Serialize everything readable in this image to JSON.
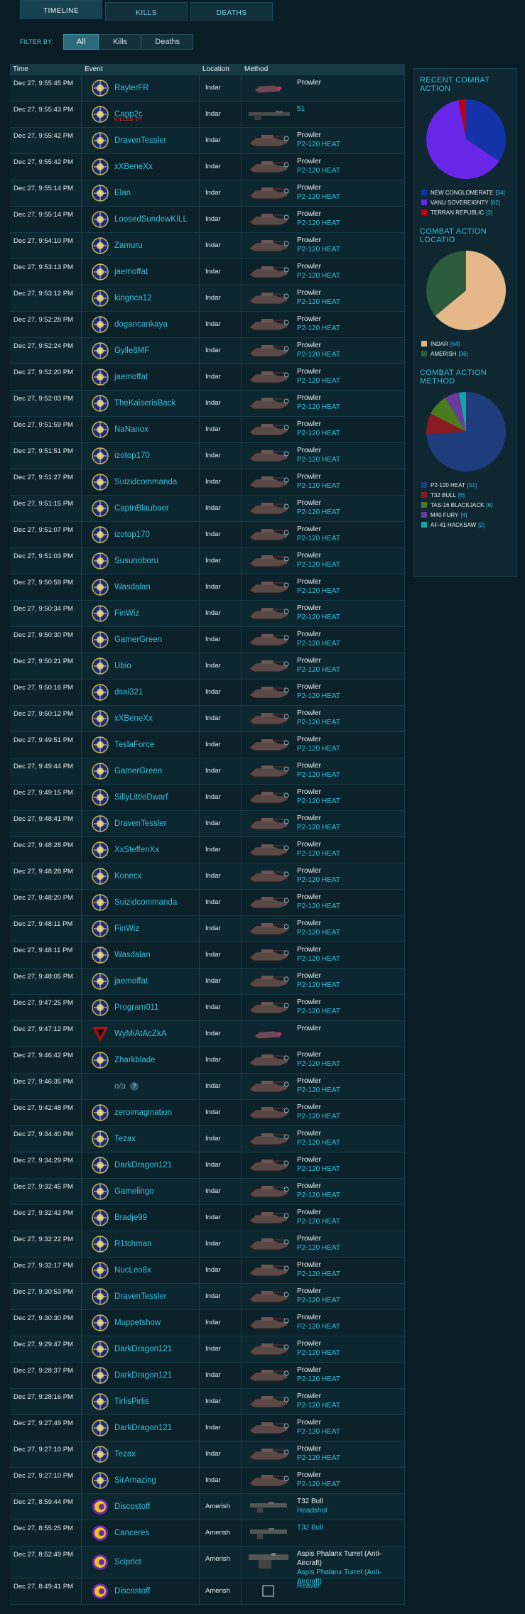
{
  "tabs": [
    "TIMELINE",
    "KILLS",
    "DEATHS"
  ],
  "filter": {
    "label": "FILTER BY:",
    "options": [
      "All",
      "Kills",
      "Deaths"
    ]
  },
  "table": {
    "headers": [
      "Time",
      "Event",
      "Location",
      "Method"
    ],
    "rows": [
      {
        "time": "Dec 27, 9:55:45 PM",
        "name": "RaylerFR",
        "faction": "nc",
        "location": "Indar",
        "vehicle": "prowler-small",
        "m1": "Prowler",
        "m2": ""
      },
      {
        "time": "Dec 27, 9:55:43 PM",
        "name": "Capp2c",
        "faction": "nc",
        "killed_by": "KILLED BY",
        "location": "Indar",
        "vehicle": "gun-long",
        "m1": "",
        "m2": "51"
      },
      {
        "time": "Dec 27, 9:55:42 PM",
        "name": "DravenTessler",
        "faction": "nc",
        "location": "Indar",
        "vehicle": "prowler",
        "m1": "Prowler",
        "m2": "P2-120 HEAT"
      },
      {
        "time": "Dec 27, 9:55:42 PM",
        "name": "xXBeneXx",
        "faction": "nc",
        "location": "Indar",
        "vehicle": "prowler",
        "m1": "Prowler",
        "m2": "P2-120 HEAT"
      },
      {
        "time": "Dec 27, 9:55:14 PM",
        "name": "Elan",
        "faction": "nc",
        "location": "Indar",
        "vehicle": "prowler",
        "m1": "Prowler",
        "m2": "P2-120 HEAT"
      },
      {
        "time": "Dec 27, 9:55:14 PM",
        "name": "LoosedSundewKILL",
        "faction": "nc",
        "location": "Indar",
        "vehicle": "prowler",
        "m1": "Prowler",
        "m2": "P2-120 HEAT"
      },
      {
        "time": "Dec 27, 9:54:10 PM",
        "name": "Zamuru",
        "faction": "nc",
        "location": "Indar",
        "vehicle": "prowler",
        "m1": "Prowler",
        "m2": "P2-120 HEAT"
      },
      {
        "time": "Dec 27, 9:53:13 PM",
        "name": "jaemoffat",
        "faction": "nc",
        "location": "Indar",
        "vehicle": "prowler",
        "m1": "Prowler",
        "m2": "P2-120 HEAT"
      },
      {
        "time": "Dec 27, 9:53:12 PM",
        "name": "kingnca12",
        "faction": "nc",
        "location": "Indar",
        "vehicle": "prowler",
        "m1": "Prowler",
        "m2": "P2-120 HEAT"
      },
      {
        "time": "Dec 27, 9:52:28 PM",
        "name": "dogancankaya",
        "faction": "nc",
        "location": "Indar",
        "vehicle": "prowler",
        "m1": "Prowler",
        "m2": "P2-120 HEAT"
      },
      {
        "time": "Dec 27, 9:52:24 PM",
        "name": "Gylle8MF",
        "faction": "nc",
        "location": "Indar",
        "vehicle": "prowler",
        "m1": "Prowler",
        "m2": "P2-120 HEAT"
      },
      {
        "time": "Dec 27, 9:52:20 PM",
        "name": "jaemoffat",
        "faction": "nc",
        "location": "Indar",
        "vehicle": "prowler",
        "m1": "Prowler",
        "m2": "P2-120 HEAT"
      },
      {
        "time": "Dec 27, 9:52:03 PM",
        "name": "TheKaiserisBack",
        "faction": "nc",
        "location": "Indar",
        "vehicle": "prowler",
        "m1": "Prowler",
        "m2": "P2-120 HEAT"
      },
      {
        "time": "Dec 27, 9:51:59 PM",
        "name": "NaNanox",
        "faction": "nc",
        "location": "Indar",
        "vehicle": "prowler",
        "m1": "Prowler",
        "m2": "P2-120 HEAT"
      },
      {
        "time": "Dec 27, 9:51:51 PM",
        "name": "izotop170",
        "faction": "nc",
        "location": "Indar",
        "vehicle": "prowler",
        "m1": "Prowler",
        "m2": "P2-120 HEAT"
      },
      {
        "time": "Dec 27, 9:51:27 PM",
        "name": "Suizidcommanda",
        "faction": "nc",
        "location": "Indar",
        "vehicle": "prowler",
        "m1": "Prowler",
        "m2": "P2-120 HEAT"
      },
      {
        "time": "Dec 27, 9:51:15 PM",
        "name": "CaptnBlaubaer",
        "faction": "nc",
        "location": "Indar",
        "vehicle": "prowler",
        "m1": "Prowler",
        "m2": "P2-120 HEAT"
      },
      {
        "time": "Dec 27, 9:51:07 PM",
        "name": "izotop170",
        "faction": "nc",
        "location": "Indar",
        "vehicle": "prowler",
        "m1": "Prowler",
        "m2": "P2-120 HEAT"
      },
      {
        "time": "Dec 27, 9:51:03 PM",
        "name": "Susunoboru",
        "faction": "nc",
        "location": "Indar",
        "vehicle": "prowler",
        "m1": "Prowler",
        "m2": "P2-120 HEAT"
      },
      {
        "time": "Dec 27, 9:50:59 PM",
        "name": "Wasdalan",
        "faction": "nc",
        "location": "Indar",
        "vehicle": "prowler",
        "m1": "Prowler",
        "m2": "P2-120 HEAT"
      },
      {
        "time": "Dec 27, 9:50:34 PM",
        "name": "FinWiz",
        "faction": "nc",
        "location": "Indar",
        "vehicle": "prowler",
        "m1": "Prowler",
        "m2": "P2-120 HEAT"
      },
      {
        "time": "Dec 27, 9:50:30 PM",
        "name": "GamerGreen",
        "faction": "nc",
        "location": "Indar",
        "vehicle": "prowler",
        "m1": "Prowler",
        "m2": "P2-120 HEAT"
      },
      {
        "time": "Dec 27, 9:50:21 PM",
        "name": "Ubio",
        "faction": "nc",
        "location": "Indar",
        "vehicle": "prowler",
        "m1": "Prowler",
        "m2": "P2-120 HEAT"
      },
      {
        "time": "Dec 27, 9:50:16 PM",
        "name": "dsai321",
        "faction": "nc",
        "location": "Indar",
        "vehicle": "prowler",
        "m1": "Prowler",
        "m2": "P2-120 HEAT"
      },
      {
        "time": "Dec 27, 9:50:12 PM",
        "name": "xXBeneXx",
        "faction": "nc",
        "location": "Indar",
        "vehicle": "prowler",
        "m1": "Prowler",
        "m2": "P2-120 HEAT"
      },
      {
        "time": "Dec 27, 9:49:51 PM",
        "name": "TeslaForce",
        "faction": "nc",
        "location": "Indar",
        "vehicle": "prowler",
        "m1": "Prowler",
        "m2": "P2-120 HEAT"
      },
      {
        "time": "Dec 27, 9:49:44 PM",
        "name": "GamerGreen",
        "faction": "nc",
        "location": "Indar",
        "vehicle": "prowler",
        "m1": "Prowler",
        "m2": "P2-120 HEAT"
      },
      {
        "time": "Dec 27, 9:49:15 PM",
        "name": "SillyLittleDwarf",
        "faction": "nc",
        "location": "Indar",
        "vehicle": "prowler",
        "m1": "Prowler",
        "m2": "P2-120 HEAT"
      },
      {
        "time": "Dec 27, 9:48:41 PM",
        "name": "DravenTessler",
        "faction": "nc",
        "location": "Indar",
        "vehicle": "prowler",
        "m1": "Prowler",
        "m2": "P2-120 HEAT"
      },
      {
        "time": "Dec 27, 9:48:28 PM",
        "name": "XxSteffenXx",
        "faction": "nc",
        "location": "Indar",
        "vehicle": "prowler",
        "m1": "Prowler",
        "m2": "P2-120 HEAT"
      },
      {
        "time": "Dec 27, 9:48:28 PM",
        "name": "Konecx",
        "faction": "nc",
        "location": "Indar",
        "vehicle": "prowler",
        "m1": "Prowler",
        "m2": "P2-120 HEAT"
      },
      {
        "time": "Dec 27, 9:48:20 PM",
        "name": "Suizidcommanda",
        "faction": "nc",
        "location": "Indar",
        "vehicle": "prowler",
        "m1": "Prowler",
        "m2": "P2-120 HEAT"
      },
      {
        "time": "Dec 27, 9:48:11 PM",
        "name": "FinWiz",
        "faction": "nc",
        "location": "Indar",
        "vehicle": "prowler",
        "m1": "Prowler",
        "m2": "P2-120 HEAT"
      },
      {
        "time": "Dec 27, 9:48:11 PM",
        "name": "Wasdalan",
        "faction": "nc",
        "location": "Indar",
        "vehicle": "prowler",
        "m1": "Prowler",
        "m2": "P2-120 HEAT"
      },
      {
        "time": "Dec 27, 9:48:05 PM",
        "name": "jaemoffat",
        "faction": "nc",
        "location": "Indar",
        "vehicle": "prowler",
        "m1": "Prowler",
        "m2": "P2-120 HEAT"
      },
      {
        "time": "Dec 27, 9:47:25 PM",
        "name": "Program011",
        "faction": "nc",
        "location": "Indar",
        "vehicle": "prowler",
        "m1": "Prowler",
        "m2": "P2-120 HEAT"
      },
      {
        "time": "Dec 27, 9:47:12 PM",
        "name": "WyMiAtAcZkA",
        "faction": "tr",
        "location": "Indar",
        "vehicle": "prowler-small",
        "m1": "Prowler",
        "m2": ""
      },
      {
        "time": "Dec 27, 9:46:42 PM",
        "name": "Zharkblade",
        "faction": "nc",
        "location": "Indar",
        "vehicle": "prowler",
        "m1": "Prowler",
        "m2": "P2-120 HEAT"
      },
      {
        "time": "Dec 27, 9:46:35 PM",
        "name": "n/a",
        "faction": "none",
        "location": "Indar",
        "vehicle": "prowler",
        "m1": "Prowler",
        "m2": "P2-120 HEAT"
      },
      {
        "time": "Dec 27, 9:42:48 PM",
        "name": "zeroimagination",
        "faction": "nc",
        "location": "Indar",
        "vehicle": "prowler",
        "m1": "Prowler",
        "m2": "P2-120 HEAT"
      },
      {
        "time": "Dec 27, 9:34:40 PM",
        "name": "Tezax",
        "faction": "nc",
        "location": "Indar",
        "vehicle": "prowler",
        "m1": "Prowler",
        "m2": "P2-120 HEAT"
      },
      {
        "time": "Dec 27, 9:34:29 PM",
        "name": "DarkDragon121",
        "faction": "nc",
        "location": "Indar",
        "vehicle": "prowler",
        "m1": "Prowler",
        "m2": "P2-120 HEAT"
      },
      {
        "time": "Dec 27, 9:32:45 PM",
        "name": "Gamelingo",
        "faction": "nc",
        "location": "Indar",
        "vehicle": "prowler",
        "m1": "Prowler",
        "m2": "P2-120 HEAT"
      },
      {
        "time": "Dec 27, 9:32:42 PM",
        "name": "Bradje99",
        "faction": "nc",
        "location": "Indar",
        "vehicle": "prowler",
        "m1": "Prowler",
        "m2": "P2-120 HEAT"
      },
      {
        "time": "Dec 27, 9:32:22 PM",
        "name": "R1tchman",
        "faction": "nc",
        "location": "Indar",
        "vehicle": "prowler",
        "m1": "Prowler",
        "m2": "P2-120 HEAT"
      },
      {
        "time": "Dec 27, 9:32:17 PM",
        "name": "NucLeo8x",
        "faction": "nc",
        "location": "Indar",
        "vehicle": "prowler",
        "m1": "Prowler",
        "m2": "P2-120 HEAT"
      },
      {
        "time": "Dec 27, 9:30:53 PM",
        "name": "DravenTessler",
        "faction": "nc",
        "location": "Indar",
        "vehicle": "prowler",
        "m1": "Prowler",
        "m2": "P2-120 HEAT"
      },
      {
        "time": "Dec 27, 9:30:30 PM",
        "name": "Muppetshow",
        "faction": "nc",
        "location": "Indar",
        "vehicle": "prowler",
        "m1": "Prowler",
        "m2": "P2-120 HEAT"
      },
      {
        "time": "Dec 27, 9:29:47 PM",
        "name": "DarkDragon121",
        "faction": "nc",
        "location": "Indar",
        "vehicle": "prowler",
        "m1": "Prowler",
        "m2": "P2-120 HEAT"
      },
      {
        "time": "Dec 27, 9:28:37 PM",
        "name": "DarkDragon121",
        "faction": "nc",
        "location": "Indar",
        "vehicle": "prowler",
        "m1": "Prowler",
        "m2": "P2-120 HEAT"
      },
      {
        "time": "Dec 27, 9:28:16 PM",
        "name": "TirlisPirlis",
        "faction": "nc",
        "location": "Indar",
        "vehicle": "prowler",
        "m1": "Prowler",
        "m2": "P2-120 HEAT"
      },
      {
        "time": "Dec 27, 9:27:49 PM",
        "name": "DarkDragon121",
        "faction": "nc",
        "location": "Indar",
        "vehicle": "prowler",
        "m1": "Prowler",
        "m2": "P2-120 HEAT"
      },
      {
        "time": "Dec 27, 9:27:10 PM",
        "name": "Tezax",
        "faction": "nc",
        "location": "Indar",
        "vehicle": "prowler",
        "m1": "Prowler",
        "m2": "P2-120 HEAT"
      },
      {
        "time": "Dec 27, 9:27:10 PM",
        "name": "SirAmazing",
        "faction": "nc",
        "location": "Indar",
        "vehicle": "prowler",
        "m1": "Prowler",
        "m2": "P2-120 HEAT"
      },
      {
        "time": "Dec 27, 8:59:44 PM",
        "name": "Discostoff",
        "faction": "vs",
        "location": "Amerish",
        "vehicle": "gun",
        "m1": "T32 Bull",
        "m2": "Headshot"
      },
      {
        "time": "Dec 27, 8:55:25 PM",
        "name": "Canceres",
        "faction": "vs",
        "location": "Amerish",
        "vehicle": "gun",
        "m1": "",
        "m2": "T32 Bull"
      },
      {
        "time": "Dec 27, 8:52:49 PM",
        "name": "Sciprict",
        "faction": "vs",
        "location": "Amerish",
        "vehicle": "turret",
        "m1": "Aspis Phalanx Turret (Anti-Aircraft)",
        "m2": "Aspis Phalanx Turret (Anti-Aircraft)"
      },
      {
        "time": "Dec 27, 8:49:41 PM",
        "name": "Discostoff",
        "faction": "vs",
        "location": "Amerish",
        "vehicle": "box",
        "m1": "",
        "m2": "Reaver"
      }
    ]
  },
  "sidebar": {
    "sections": [
      {
        "title": "RECENT COMBAT ACTION",
        "chart_data": {
          "type": "pie",
          "title": "RECENT COMBAT ACTION",
          "labels": [
            "NEW CONGLOMERATE",
            "VANU SOVEREIGNTY",
            "TERRAN REPUBLIC"
          ],
          "values": [
            34,
            62,
            3
          ],
          "colors": [
            "#1533a8",
            "#6a26e6",
            "#c00010"
          ]
        }
      },
      {
        "title": "COMBAT ACTION LOCATIO",
        "chart_data": {
          "type": "pie",
          "title": "COMBAT ACTION LOCATIO",
          "labels": [
            "INDAR",
            "AMERISH"
          ],
          "values": [
            64,
            36
          ],
          "colors": [
            "#e6b889",
            "#2b5c3c"
          ]
        }
      },
      {
        "title": "COMBAT ACTION METHOD",
        "chart_data": {
          "type": "pie",
          "title": "COMBAT ACTION METHOD",
          "labels": [
            "P2-120 HEAT",
            "T32 BULL",
            "TAS-16 BLACKJACK",
            "M40 FURY",
            "AF-41 HACKSAW"
          ],
          "values": [
            51,
            6,
            6,
            4,
            2
          ],
          "colors": [
            "#1f3c7c",
            "#8a1a22",
            "#4c7a1e",
            "#6a3aa0",
            "#0fa7a0"
          ]
        }
      }
    ]
  }
}
